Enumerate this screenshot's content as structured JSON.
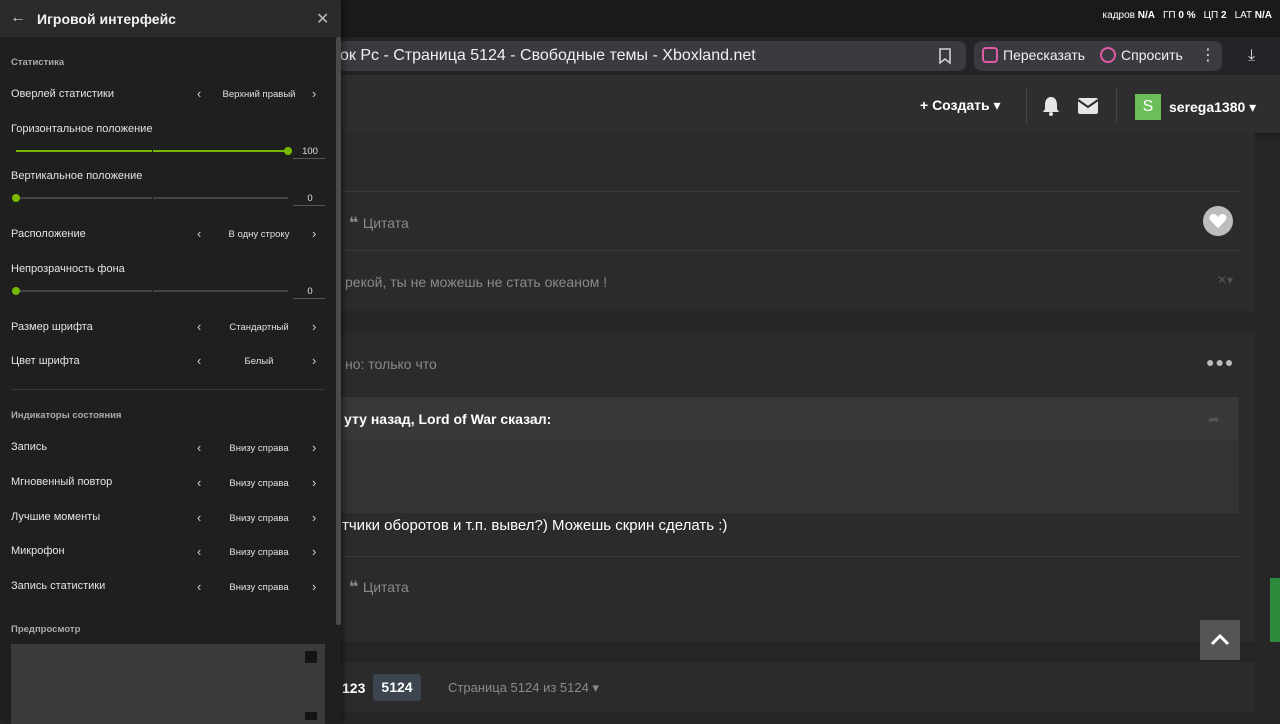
{
  "topstrip": {
    "stats": [
      {
        "label": "кадров",
        "value": "N/A"
      },
      {
        "label": "ГП",
        "value": "0 %"
      },
      {
        "label": "ЦП",
        "value": "2"
      },
      {
        "label": "LAT",
        "value": "N/A"
      }
    ]
  },
  "browser": {
    "tab_title": "ок Pc - Страница 5124 - Свободные темы - Xboxland.net",
    "retell_label": "Пересказать",
    "ask_label": "Спросить",
    "more_glyph": "⋮",
    "download_glyph": "⤓"
  },
  "site_header": {
    "create_label": "+ Создать ▾",
    "avatar_letter": "S",
    "username": "serega1380 ▾"
  },
  "forum": {
    "quote_label_1": "Цитата",
    "signature": "рекой, ты не можешь не стать океаном !",
    "post_time": "но: только что",
    "quote_author": "уту назад, Lord of War сказал:",
    "post_body": "тчики оборотов и т.п. вывел?) Можешь скрин сделать :)",
    "quote_label_2": "Цитата",
    "page_prev": "123",
    "page_current": "5124",
    "page_of": "Страница 5124 из 5124 ▾"
  },
  "panel": {
    "title": "Игровой интерфейс",
    "sections": {
      "statistics": "Статистика",
      "indicators": "Индикаторы состояния",
      "preview": "Предпросмотр"
    },
    "rows": {
      "overlay": {
        "label": "Оверлей статистики",
        "value": "Верхний правый"
      },
      "horizontal": {
        "label": "Горизонтальное положение",
        "value": "100"
      },
      "vertical": {
        "label": "Вертикальное положение",
        "value": "0"
      },
      "layout": {
        "label": "Расположение",
        "value": "В одну строку"
      },
      "opacity": {
        "label": "Непрозрачность фона",
        "value": "0"
      },
      "font_size": {
        "label": "Размер шрифта",
        "value": "Стандартный"
      },
      "font_color": {
        "label": "Цвет шрифта",
        "value": "Белый"
      },
      "record": {
        "label": "Запись",
        "value": "Внизу справа"
      },
      "instant_replay": {
        "label": "Мгновенный повтор",
        "value": "Внизу справа"
      },
      "highlights": {
        "label": "Лучшие моменты",
        "value": "Внизу справа"
      },
      "microphone": {
        "label": "Микрофон",
        "value": "Внизу справа"
      },
      "stats_record": {
        "label": "Запись статистики",
        "value": "Внизу справа"
      }
    },
    "slider_levels": {
      "horizontal": 1.0,
      "vertical": 0.0,
      "opacity": 0.0
    },
    "accent_color": "#76b900"
  }
}
